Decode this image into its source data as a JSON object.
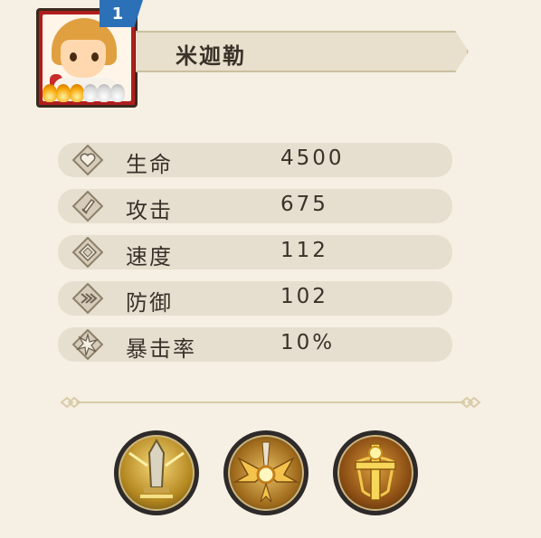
{
  "hero": {
    "level": "1",
    "name": "米迦勒",
    "portrait_icon": "hero-portrait",
    "stars": [
      {
        "type": "gold"
      },
      {
        "type": "gold"
      },
      {
        "type": "gold"
      },
      {
        "type": "grey"
      },
      {
        "type": "grey"
      },
      {
        "type": "grey"
      }
    ]
  },
  "stats": [
    {
      "label": "生命",
      "value": "4500",
      "icon": "heart-icon"
    },
    {
      "label": "攻击",
      "value": "675",
      "icon": "sword-icon"
    },
    {
      "label": "速度",
      "value": "112",
      "icon": "diamond-icon"
    },
    {
      "label": "防御",
      "value": "102",
      "icon": "shield-chevron-icon"
    },
    {
      "label": "暴击率",
      "value": "10%",
      "icon": "crit-burst-icon"
    }
  ],
  "skills": [
    {
      "icon": "sword-rays-skill-icon"
    },
    {
      "icon": "golden-wings-skill-icon"
    },
    {
      "icon": "holy-cross-skill-icon"
    }
  ],
  "colors": {
    "background": "#f5f0e3",
    "stat_bar": "#e6dfd0",
    "text": "#3a3128",
    "level_badge": "#2c70b8",
    "portrait_frame": "#b11d1d",
    "gold": "#f2b31b"
  }
}
